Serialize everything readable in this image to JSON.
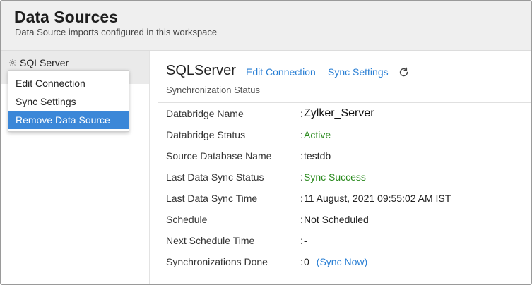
{
  "header": {
    "title": "Data Sources",
    "subtitle": "Data Source imports configured in this workspace"
  },
  "sidebar": {
    "items": [
      {
        "label": "SQLServer",
        "icon": "gear-icon"
      }
    ]
  },
  "context_menu": {
    "items": [
      {
        "label": "Edit Connection"
      },
      {
        "label": "Sync Settings"
      },
      {
        "label": "Remove Data Source",
        "highlighted": true
      }
    ]
  },
  "main": {
    "title": "SQLServer",
    "edit_connection": "Edit Connection",
    "sync_settings": "Sync Settings",
    "refresh_icon": "refresh-icon",
    "section_heading": "Synchronization Status",
    "rows": [
      {
        "label": "Databridge Name",
        "colon": ":",
        "value": "Zylker_Server"
      },
      {
        "label": "Databridge Status",
        "colon": ":",
        "value": "Active"
      },
      {
        "label": "Source Database Name",
        "colon": ":",
        "value": "testdb"
      },
      {
        "label": "Last Data Sync Status",
        "colon": ":",
        "value": "Sync Success"
      },
      {
        "label": "Last Data Sync Time",
        "colon": ":",
        "value": "11 August, 2021 09:55:02 AM IST"
      },
      {
        "label": "Schedule",
        "colon": ":",
        "value": "Not Scheduled"
      },
      {
        "label": "Next Schedule Time",
        "colon": ":",
        "value": "-"
      },
      {
        "label": "Synchronizations Done",
        "colon": ":",
        "value": "0",
        "link": "(Sync Now)"
      }
    ]
  },
  "colors": {
    "link": "#2a7fd4",
    "highlight": "#3b87d8",
    "success": "#2a8a1e"
  }
}
